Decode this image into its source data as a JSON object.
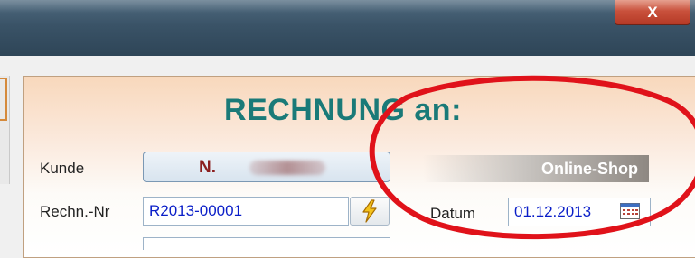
{
  "window": {
    "close_glyph": "X"
  },
  "form": {
    "heading": "RECHNUNG an:",
    "kunde_label": "Kunde",
    "kunde_value": "N.",
    "online_shop": "Online-Shop",
    "rechn_label": "Rechn.-Nr",
    "rechn_value": "R2013-00001",
    "datum_label": "Datum",
    "datum_value": "01.12.2013"
  },
  "colors": {
    "heading": "#1a7a78",
    "kunde_name": "#8b1e1e",
    "input_text": "#0a1ec8",
    "highlight_ellipse": "#e0121a"
  },
  "icons": {
    "bolt": "lightning-icon",
    "calendar": "calendar-icon"
  }
}
